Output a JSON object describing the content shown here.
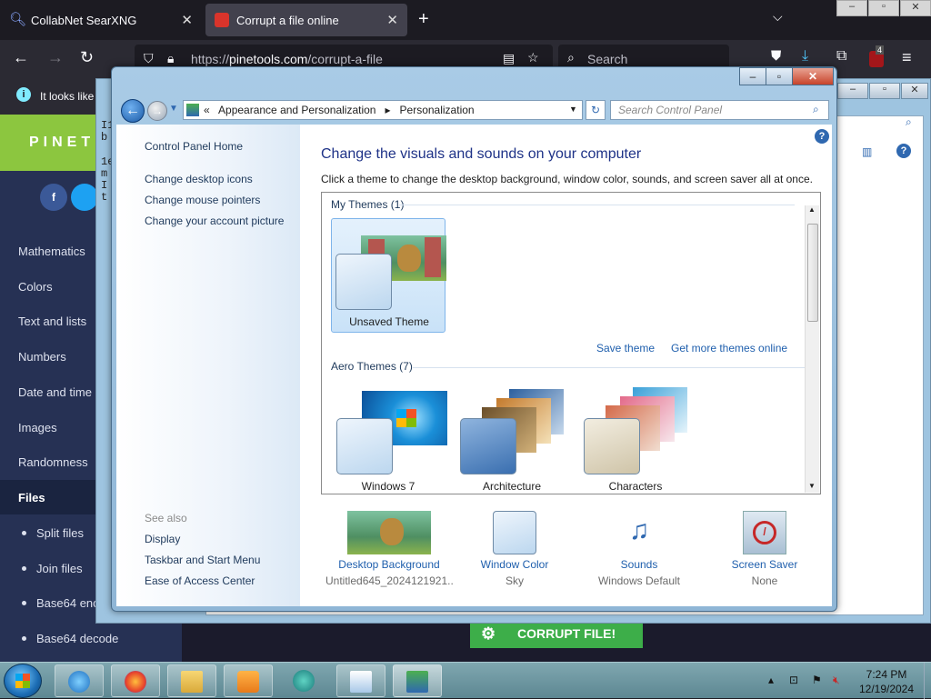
{
  "browser": {
    "tabs": [
      {
        "label": "CollabNet SearXNG"
      },
      {
        "label": "Corrupt a file online"
      }
    ],
    "url_prefix": "https://",
    "url_domain": "pinetools.com",
    "url_path": "/corrupt-a-file",
    "search_placeholder": "Search",
    "notification": "It looks like",
    "ext_badge": "4"
  },
  "pinetools": {
    "logo": "PINET",
    "nav": [
      "Mathematics",
      "Colors",
      "Text and lists",
      "Numbers",
      "Date and time",
      "Images",
      "Randomness",
      "Files"
    ],
    "subnav": [
      "Split files",
      "Join files",
      "Base64 enco",
      "Base64 decode"
    ],
    "button": "CORRUPT FILE!",
    "text_snippets": [
      "I1",
      "b",
      "1e",
      "m",
      "I",
      "t"
    ]
  },
  "control_panel": {
    "breadcrumb": [
      "Appearance and Personalization",
      "Personalization"
    ],
    "search_placeholder": "Search Control Panel",
    "left": {
      "home": "Control Panel Home",
      "links": [
        "Change desktop icons",
        "Change mouse pointers",
        "Change your account picture"
      ],
      "see_also_label": "See also",
      "see_also": [
        "Display",
        "Taskbar and Start Menu",
        "Ease of Access Center"
      ]
    },
    "title": "Change the visuals and sounds on your computer",
    "description": "Click a theme to change the desktop background, window color, sounds, and screen saver all at once.",
    "my_themes_label": "My Themes (1)",
    "my_themes": [
      {
        "name": "Unsaved Theme"
      }
    ],
    "save_theme": "Save theme",
    "get_more": "Get more themes online",
    "aero_label": "Aero Themes (7)",
    "aero_themes": [
      {
        "name": "Windows 7"
      },
      {
        "name": "Architecture"
      },
      {
        "name": "Characters"
      }
    ],
    "bottom": [
      {
        "label": "Desktop Background",
        "value": "Untitled645_2024121921..."
      },
      {
        "label": "Window Color",
        "value": "Sky"
      },
      {
        "label": "Sounds",
        "value": "Windows Default"
      },
      {
        "label": "Screen Saver",
        "value": "None"
      }
    ]
  },
  "taskbar": {
    "time": "7:24 PM",
    "date": "12/19/2024"
  }
}
